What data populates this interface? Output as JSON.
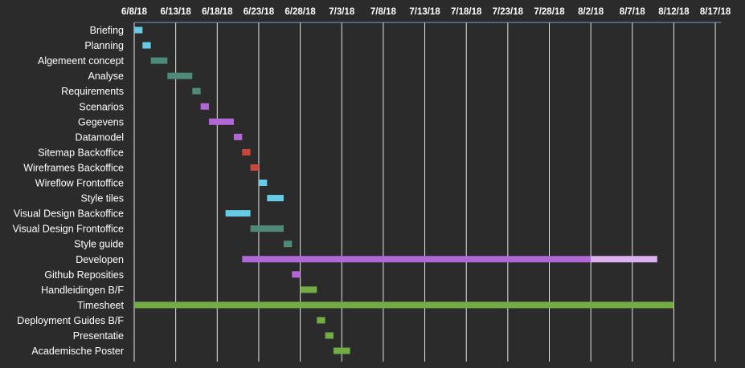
{
  "chart_data": {
    "type": "gantt",
    "x_ticks": [
      "6/8/18",
      "6/13/18",
      "6/18/18",
      "6/23/18",
      "6/28/18",
      "7/3/18",
      "7/8/18",
      "7/13/18",
      "7/18/18",
      "7/23/18",
      "7/28/18",
      "8/2/18",
      "8/7/18",
      "8/12/18",
      "8/17/18"
    ],
    "axis_start": "2018-06-08",
    "axis_end": "2018-08-19",
    "grid": "vertical",
    "colors": {
      "background": "#2b2b2b",
      "grid": "#e6e6e6",
      "axis": "#7e97c6",
      "text": "#ffffff"
    },
    "tasks": [
      {
        "name": "Briefing",
        "start": "2018-06-08",
        "end": "2018-06-09",
        "color": "#67cbe6"
      },
      {
        "name": "Planning",
        "start": "2018-06-09",
        "end": "2018-06-10",
        "color": "#67cbe6"
      },
      {
        "name": "Algemeent concept",
        "start": "2018-06-10",
        "end": "2018-06-12",
        "color": "#4e8a77"
      },
      {
        "name": "Analyse",
        "start": "2018-06-12",
        "end": "2018-06-15",
        "color": "#4e8a77"
      },
      {
        "name": "Requirements",
        "start": "2018-06-15",
        "end": "2018-06-16",
        "color": "#4e8a77"
      },
      {
        "name": "Scenarios",
        "start": "2018-06-16",
        "end": "2018-06-17",
        "color": "#b267d6"
      },
      {
        "name": "Gegevens",
        "start": "2018-06-17",
        "end": "2018-06-20",
        "color": "#b267d6"
      },
      {
        "name": "Datamodel",
        "start": "2018-06-20",
        "end": "2018-06-21",
        "color": "#b267d6"
      },
      {
        "name": "Sitemap Backoffice",
        "start": "2018-06-21",
        "end": "2018-06-22",
        "color": "#c9473a"
      },
      {
        "name": "Wireframes Backoffice",
        "start": "2018-06-22",
        "end": "2018-06-23",
        "color": "#c9473a"
      },
      {
        "name": "Wireflow Frontoffice",
        "start": "2018-06-23",
        "end": "2018-06-24",
        "color": "#67cbe6"
      },
      {
        "name": "Style tiles",
        "start": "2018-06-24",
        "end": "2018-06-26",
        "color": "#67cbe6"
      },
      {
        "name": "Visual Design Backoffice",
        "start": "2018-06-19",
        "end": "2018-06-22",
        "color": "#67cbe6"
      },
      {
        "name": "Visual Design Frontoffice",
        "start": "2018-06-22",
        "end": "2018-06-26",
        "color": "#4e8a77"
      },
      {
        "name": "Style guide",
        "start": "2018-06-26",
        "end": "2018-06-27",
        "color": "#4e8a77"
      },
      {
        "name": "Developen",
        "start": "2018-06-21",
        "end": "2018-08-02",
        "progress_end": "2018-08-02",
        "full_end": "2018-08-10",
        "color": "#b267d6",
        "remaining_color": "#ddb0ee"
      },
      {
        "name": "Github Reposities",
        "start": "2018-06-27",
        "end": "2018-06-28",
        "color": "#b267d6"
      },
      {
        "name": "Handleidingen B/F",
        "start": "2018-06-28",
        "end": "2018-06-30",
        "color": "#73ab45"
      },
      {
        "name": "Timesheet",
        "start": "2018-06-08",
        "end": "2018-08-12",
        "color": "#73ab45"
      },
      {
        "name": "Deployment Guides B/F",
        "start": "2018-06-30",
        "end": "2018-07-01",
        "color": "#73ab45"
      },
      {
        "name": "Presentatie",
        "start": "2018-07-01",
        "end": "2018-07-02",
        "color": "#73ab45"
      },
      {
        "name": "Academische Poster",
        "start": "2018-07-02",
        "end": "2018-07-04",
        "color": "#73ab45"
      }
    ]
  }
}
